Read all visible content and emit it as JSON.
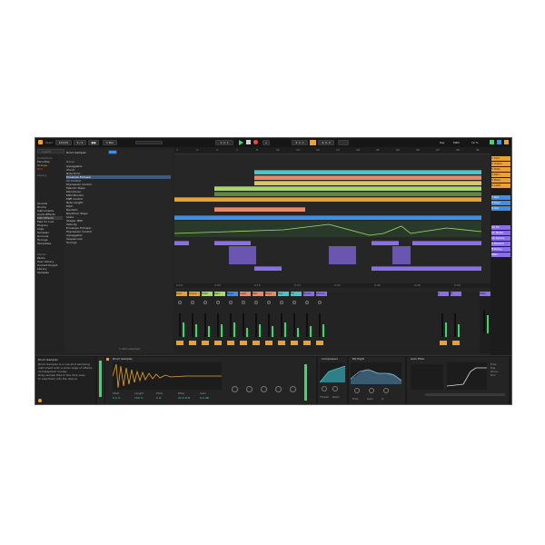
{
  "transport": {
    "tempo": "120.00",
    "time_sig": "4 / 4",
    "position": "1. 1. 1",
    "loop_start": "3. 1. 1",
    "loop_length": "4. 0. 0",
    "quantize": "1 Bar",
    "key": "Key",
    "midi": "MIDI",
    "cpu": "12 %"
  },
  "browser": {
    "search_placeholder": "Search",
    "collections_header": "Collections",
    "collections": [
      "Favorites",
      "Orange",
      "Red"
    ],
    "categories_header": "Library",
    "categories": [
      "Sounds",
      "Drums",
      "Instruments",
      "Audio Effects",
      "MIDI Effects",
      "Max for Live",
      "Plug-Ins",
      "Clips",
      "Samples",
      "Grooves",
      "Tunings",
      "Templates"
    ],
    "places_header": "Places",
    "places": [
      "Packs",
      "User Library",
      "Current Project",
      "Library",
      "Samples"
    ],
    "list_header": "Name",
    "list_items": [
      "Arpeggiator",
      "Chord",
      "Note Echo",
      "CC Control",
      "Expression Control",
      "Melodic Steps",
      "Microtuner",
      "MIDI Monitor",
      "MPE Control",
      "Note Length",
      "Pitch",
      "Random",
      "Rhythmic Steps",
      "Scale",
      "Shaper MIDI",
      "Velocity",
      "Envelope Follower",
      "Expression Control",
      "Arpeggiator",
      "Sequencers",
      "Tunings"
    ],
    "selected_item": "Envelope Follower",
    "info_title": "Drum Sampler",
    "info_text": [
      "Drum Sampler is a one-shot sampling",
      "instrument with a wide range of effects",
      "and playback modes.",
      "Drag sample files to the drop area",
      "to load them into the device."
    ],
    "footer": "1 Item selected"
  },
  "arrangement": {
    "ruler": [
      "1",
      "3",
      "5",
      "7",
      "9",
      "11",
      "13",
      "15",
      "17",
      "19",
      "21",
      "23",
      "25",
      "27",
      "29",
      "31",
      "33"
    ],
    "time_ruler": [
      "0:00",
      "0:08",
      "0:16",
      "0:24",
      "0:32",
      "0:40",
      "0:48",
      "0:56",
      "1:04"
    ]
  },
  "tracks": [
    {
      "name": "1 Kick",
      "color": "#e8a234"
    },
    {
      "name": "2 Snare",
      "color": "#e8a234"
    },
    {
      "name": "3 Hats",
      "color": "#e8a234"
    },
    {
      "name": "4 Perc",
      "color": "#e8a234"
    },
    {
      "name": "5 Bass",
      "color": "#e8a234"
    },
    {
      "name": "6 Lead",
      "color": "#e8a234"
    },
    {
      "name": "7 Pad",
      "color": "#3d8fe8"
    },
    {
      "name": "8 Keys",
      "color": "#3d8fe8"
    },
    {
      "name": "9 Vox",
      "color": "#3d8fe8"
    },
    {
      "name": "10 FX",
      "color": "#8a6fe8"
    },
    {
      "name": "11 Noise",
      "color": "#8a6fe8"
    },
    {
      "name": "12 Atmos",
      "color": "#8a6fe8"
    },
    {
      "name": "A Reverb",
      "color": "#8a6fe8"
    },
    {
      "name": "B Delay",
      "color": "#8a6fe8"
    },
    {
      "name": "Main",
      "color": "#8a6fe8"
    }
  ],
  "mixer": {
    "channels": [
      "Kick",
      "Snare",
      "Hats",
      "Perc",
      "Bass",
      "Lead",
      "Pad",
      "Keys",
      "Vox",
      "FX",
      "Noise",
      "Atmos",
      "A",
      "B",
      "Main"
    ],
    "volumes": [
      "-3.0",
      "-6.0",
      "-12",
      "-8.5",
      "-4.0",
      "-7.2",
      "-10",
      "-9.0",
      "-5.5",
      "-14",
      "-18",
      "-11",
      "0",
      "0",
      "0"
    ]
  },
  "devices": {
    "sampler_title": "Drum Sampler",
    "sampler_params": [
      "Start",
      "Length",
      "Pitch",
      "Filter",
      "Gain"
    ],
    "sampler_values": [
      "0.0 %",
      "100 %",
      "0 st",
      "22.0 kHz",
      "0.0 dB"
    ],
    "comp_title": "Compressor",
    "comp_params": [
      "Thresh",
      "Ratio",
      "Attack",
      "Release"
    ],
    "eq_title": "EQ Eight",
    "eq_params": [
      "Freq",
      "Gain",
      "Q"
    ],
    "limiter_title": "Auto Filter",
    "limiter_params": [
      "Freq",
      "Res",
      "Drive",
      "Env"
    ]
  },
  "colors": {
    "accent": "#f0a030",
    "clip_orange": "#e8a234",
    "clip_yellow": "#d9c66a",
    "clip_green": "#a8d86a",
    "clip_blue": "#3d8fe8",
    "clip_teal": "#4ac6c8",
    "clip_salmon": "#e88a6a",
    "clip_purple": "#8a6fe8",
    "play_green": "#3dd86a",
    "record_red": "#e84a3a"
  }
}
